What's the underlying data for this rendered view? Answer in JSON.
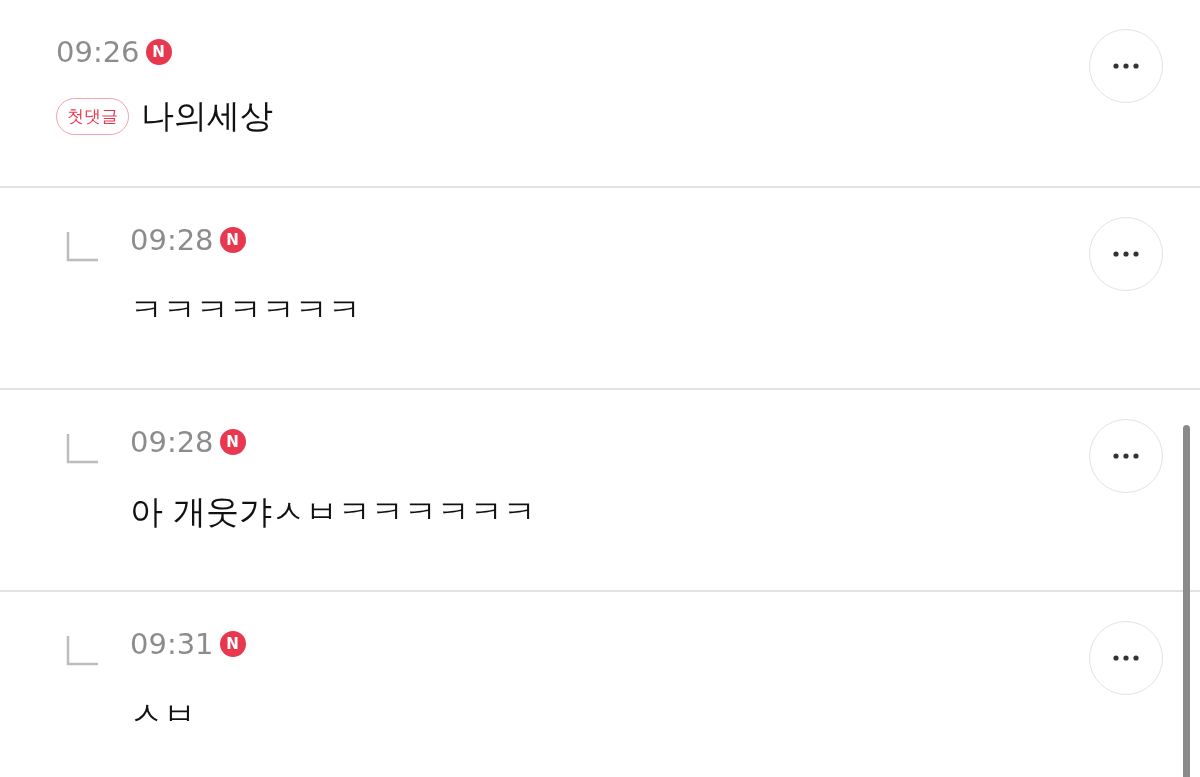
{
  "comments": [
    {
      "kind": "comment",
      "time": "09:26",
      "new_mark": "N",
      "badge": "첫댓글",
      "text": "나의세상"
    },
    {
      "kind": "reply",
      "time": "09:28",
      "new_mark": "N",
      "text": "ㅋㅋㅋㅋㅋㅋㅋ"
    },
    {
      "kind": "reply",
      "time": "09:28",
      "new_mark": "N",
      "text": "아 개웃갸ㅅㅂㅋㅋㅋㅋㅋㅋ"
    },
    {
      "kind": "reply",
      "time": "09:31",
      "new_mark": "N",
      "text": "ㅅㅂ"
    }
  ]
}
